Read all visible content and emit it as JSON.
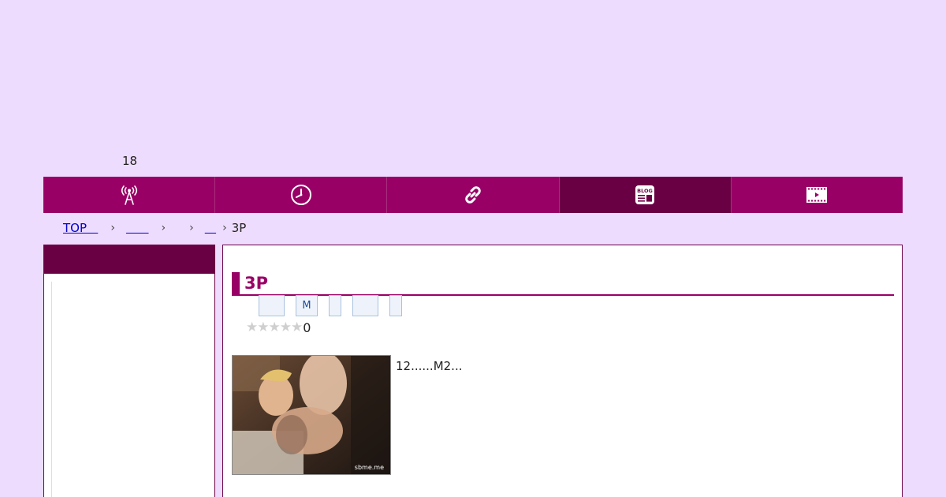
{
  "age_note": "18",
  "nav": {
    "items": [
      {
        "icon": "broadcast-tower-icon"
      },
      {
        "icon": "clock-icon"
      },
      {
        "icon": "link-icon"
      },
      {
        "icon": "blog-icon",
        "icon_text": "BLOG",
        "active": true
      },
      {
        "icon": "video-film-icon"
      }
    ]
  },
  "breadcrumb": {
    "items": [
      "TOP   ",
      "      ",
      "",
      "   "
    ],
    "separator": "›",
    "current": "3P"
  },
  "article": {
    "title": "3P",
    "tags": [
      "",
      "M",
      "",
      "",
      ""
    ],
    "rating": {
      "stars_filled": 0,
      "stars_total": 5,
      "count": "0"
    },
    "thumbnail_watermark": "sbme.me",
    "description": "12......M2..."
  },
  "colors": {
    "background": "#eedcff",
    "nav": "#990066",
    "nav_active": "#6a0044",
    "accent": "#990066"
  }
}
